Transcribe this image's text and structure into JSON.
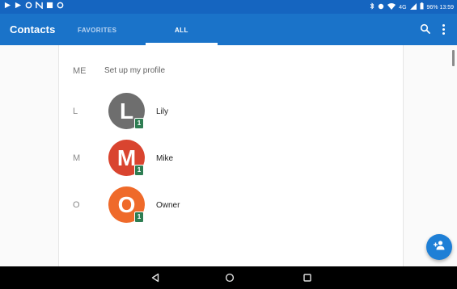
{
  "status_bar": {
    "left_icons": [
      "sync-icon",
      "sync-icon",
      "circle-icon",
      "nfc-icon",
      "gallery-icon",
      "circle-icon"
    ],
    "right_text": "96%  13:59",
    "network_label": "4G",
    "colors": {
      "background": "#1565c0"
    }
  },
  "toolbar": {
    "title": "Contacts",
    "tabs": [
      {
        "label": "FAVORITES",
        "selected": false
      },
      {
        "label": "ALL",
        "selected": true
      }
    ],
    "actions": [
      "search-icon",
      "more-vertical-icon"
    ],
    "colors": {
      "background": "#1a73c9",
      "indicator": "#ffffff"
    }
  },
  "profile": {
    "letter": "ME",
    "label": "Set up my profile"
  },
  "contacts": [
    {
      "section": "L",
      "initial": "L",
      "name": "Lily",
      "avatar_color": "#6e6e6e",
      "badge": "1"
    },
    {
      "section": "M",
      "initial": "M",
      "name": "Mike",
      "avatar_color": "#d9442f",
      "badge": "1"
    },
    {
      "section": "O",
      "initial": "O",
      "name": "Owner",
      "avatar_color": "#ef6a2a",
      "badge": "1"
    }
  ],
  "fab": {
    "icon": "add-contact-icon",
    "color": "#1e7fd6"
  },
  "nav_bar": {
    "buttons": [
      "back-icon",
      "home-icon",
      "recents-icon"
    ]
  }
}
